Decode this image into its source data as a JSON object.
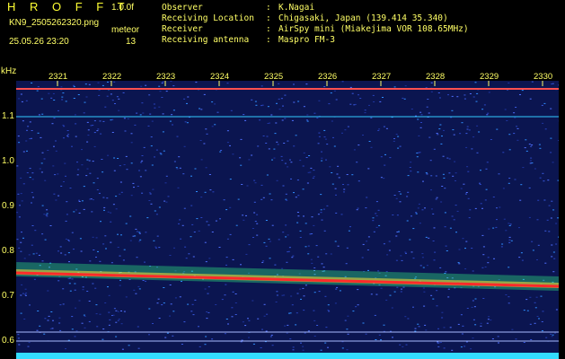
{
  "app": {
    "title": "H R O F F T",
    "version": "1.0.0f"
  },
  "file": {
    "name": "KN9_2505262320.png",
    "datetime": "25.05.26 23:20"
  },
  "meteor": {
    "label": "meteor",
    "count": "13"
  },
  "info": [
    {
      "key": "Observer",
      "sep": ":",
      "value": "K.Nagai"
    },
    {
      "key": "Receiving Location",
      "sep": ":",
      "value": "Chigasaki, Japan (139.414 35.340)"
    },
    {
      "key": "Receiver",
      "sep": ":",
      "value": "AirSpy mini (Miakejima VOR 108.65MHz)"
    },
    {
      "key": "Receiving antenna",
      "sep": ":",
      "value": "Maspro FM-3"
    }
  ],
  "axis": {
    "unit": "kHz",
    "y_ticks": [
      "1.1",
      "1.0",
      "0.9",
      "0.8",
      "0.7",
      "0.6"
    ],
    "x_ticks": [
      "2321",
      "2322",
      "2323",
      "2324",
      "2325",
      "2326",
      "2327",
      "2328",
      "2329",
      "2330"
    ]
  },
  "colors": {
    "text": "#ffff66",
    "background": "#000000",
    "noise": "#1a2d8a",
    "signal_core": "#ff3030",
    "signal_halo": "#33ff88",
    "reference_line": "#33ccff"
  }
}
